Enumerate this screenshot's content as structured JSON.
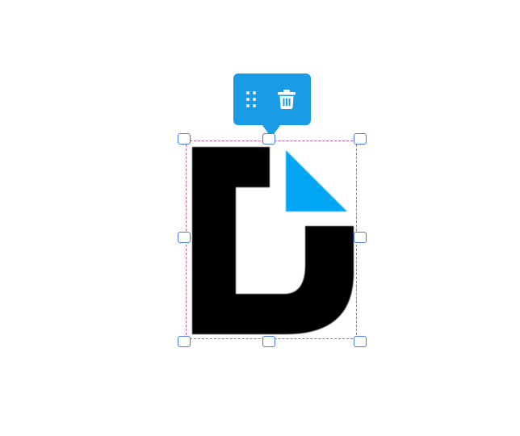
{
  "toolbar": {
    "items": [
      {
        "icon": "drag-handle-icon"
      },
      {
        "icon": "trash-icon"
      }
    ]
  },
  "selection": {
    "handles": [
      "top-left",
      "top",
      "top-right",
      "left",
      "right",
      "bottom-left",
      "bottom",
      "bottom-right"
    ]
  },
  "logo": {
    "letter_mark": "D"
  },
  "colors": {
    "toolbar_bg": "#1a9be6",
    "handle_border": "#4a7be0",
    "selection_border": "#e0589a",
    "logo_black": "#000000",
    "logo_blue": "#00a6f4"
  }
}
